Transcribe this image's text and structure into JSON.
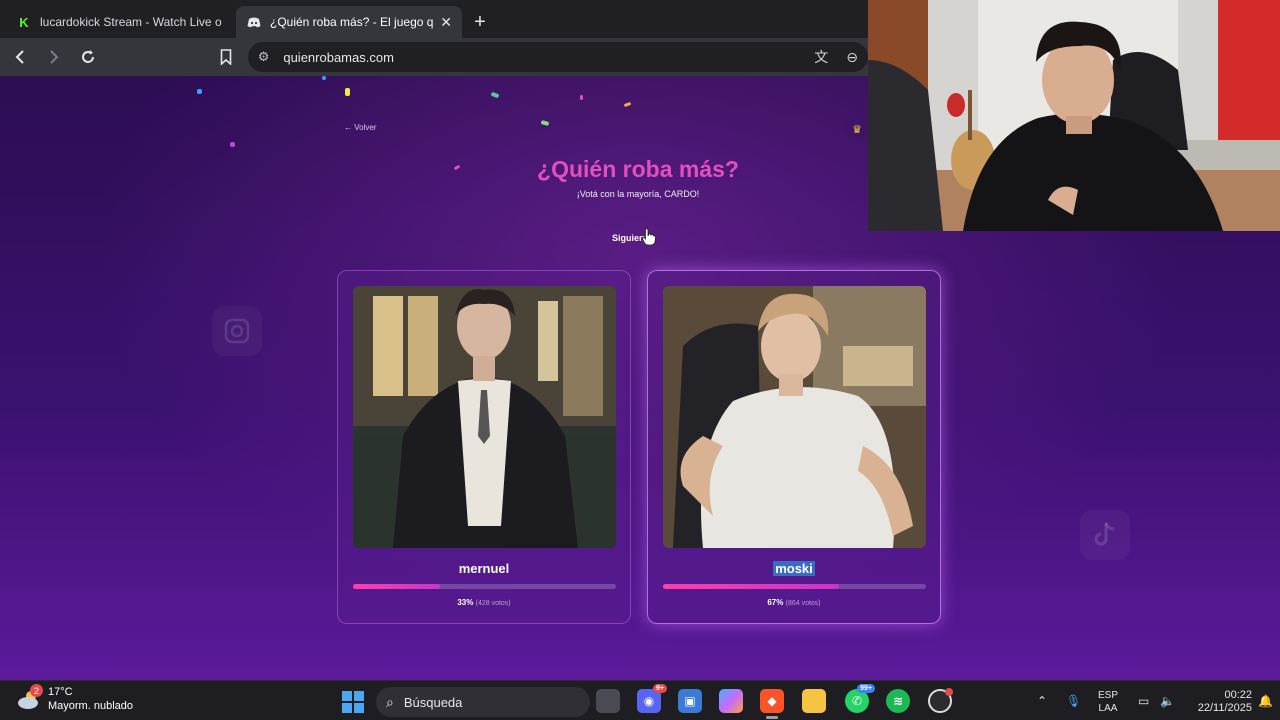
{
  "browser": {
    "tabs": [
      {
        "label": "lucardokick Stream - Watch Live on K",
        "active": false,
        "favicon": "kick-icon"
      },
      {
        "label": "¿Quién roba más? - El juego que",
        "active": true,
        "favicon": "discord-icon"
      }
    ],
    "url": "quienrobamas.com"
  },
  "page": {
    "back_label": "Volver",
    "title": "¿Quién roba más?",
    "subtitle": "¡Votá con la mayoría, CARDO!",
    "next_label": "Siguiente",
    "accent_color": "#e34ec1",
    "cards": [
      {
        "name": "mernuel",
        "percent_label": "33%",
        "votes_label": "(428 votos)",
        "percent": 33
      },
      {
        "name": "moski",
        "percent_label": "67%",
        "votes_label": "(864 votos)",
        "percent": 67
      }
    ]
  },
  "taskbar": {
    "weather_temp": "17°C",
    "weather_desc": "Mayorm. nublado",
    "weather_badge": "2",
    "search_placeholder": "Búsqueda",
    "discord_badge": "9+",
    "whatsapp_badge": "99+",
    "lang_top": "ESP",
    "lang_bottom": "LAA",
    "time": "00:22",
    "date": "22/11/2025"
  }
}
